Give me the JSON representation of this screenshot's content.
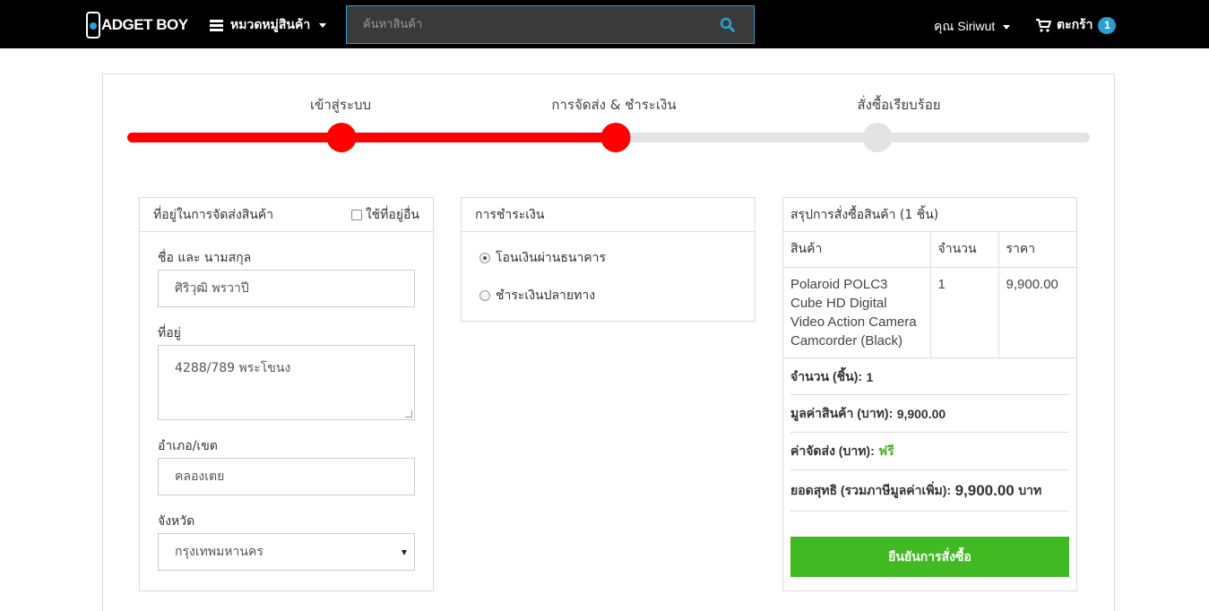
{
  "nav": {
    "logo_text": "ADGET BOY",
    "category_label": "หมวดหมู่สินค้า",
    "search_placeholder": "ค้นหาสินค้า",
    "user_label": "คุณ Siriwut",
    "cart_label": "ตะกร้า",
    "cart_count": "1"
  },
  "steps": [
    {
      "label": "เข้าสู่ระบบ",
      "status": "done"
    },
    {
      "label": "การจัดส่ง & ชำระเงิน",
      "status": "current"
    },
    {
      "label": "สั่งซื้อเรียบร้อย",
      "status": "pending"
    }
  ],
  "progress_percent": 50,
  "colors": {
    "active": "#ff0000",
    "inactive": "#e3e3e3",
    "accent": "#2a9fd6",
    "confirm": "#41b923"
  },
  "shipping": {
    "title": "ที่อยู่ในการจัดส่งสินค้า",
    "other_address_label": "ใช้ที่อยู่อื่น",
    "name_label": "ชื่อ และ นามสกุล",
    "name_value": "ศิริวุฒิ พรวาปี",
    "address_label": "ที่อยู่",
    "address_value": "4288/789 พระโขนง",
    "district_label": "อำเภอ/เขต",
    "district_value": "คลองเตย",
    "province_label": "จังหวัด",
    "province_value": "กรุงเทพมหานคร"
  },
  "payment": {
    "title": "การชำระเงิน",
    "options": [
      {
        "label": "โอนเงินผ่านธนาคาร",
        "selected": true
      },
      {
        "label": "ชำระเงินปลายทาง",
        "selected": false
      }
    ]
  },
  "summary": {
    "title": "สรุปการสั่งซื้อสินค้า (1 ชิ้น)",
    "columns": [
      "สินค้า",
      "จำนวน",
      "ราคา"
    ],
    "items": [
      {
        "product": "Polaroid POLC3 Cube HD Digital Video Action Camera Camcorder (Black)",
        "qty": "1",
        "price": "9,900.00"
      }
    ],
    "qty_label": "จำนวน (ชิ้น):",
    "qty_value": "1",
    "subtotal_label": "มูลค่าสินค้า (บาท):",
    "subtotal_value": "9,900.00",
    "shipping_label": "ค่าจัดส่ง (บาท):",
    "shipping_value": "ฟรี",
    "total_label": "ยอดสุทธิ (รวมภาษีมูลค่าเพิ่ม):",
    "total_value": "9,900.00",
    "total_unit": "บาท",
    "confirm_label": "ยืนยันการสั่งซื้อ"
  }
}
